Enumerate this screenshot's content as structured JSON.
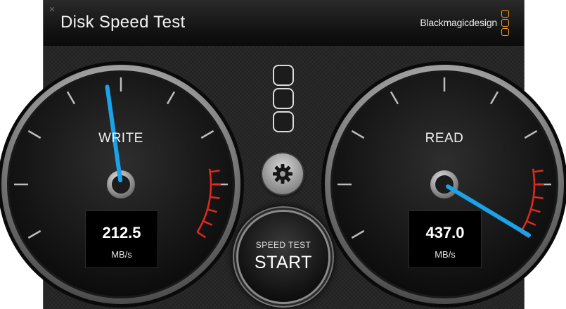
{
  "window": {
    "title": "Disk Speed Test",
    "close_icon": "close-icon",
    "brand": "Blackmagicdesign"
  },
  "write_gauge": {
    "label": "WRITE",
    "value": "212.5",
    "unit": "MB/s",
    "needle_color": "#1aa3e8",
    "danger_color": "#e02a1f"
  },
  "read_gauge": {
    "label": "READ",
    "value": "437.0",
    "unit": "MB/s",
    "needle_color": "#1aa3e8",
    "danger_color": "#e02a1f"
  },
  "start_button": {
    "top_label": "SPEED TEST",
    "main_label": "START"
  },
  "controls": {
    "target_buttons_icon": "rounded-square-icon",
    "settings_icon": "gear-icon"
  },
  "colors": {
    "brand_accent": "#f39c1f",
    "needle": "#1aa3e8",
    "danger": "#e02a1f"
  }
}
